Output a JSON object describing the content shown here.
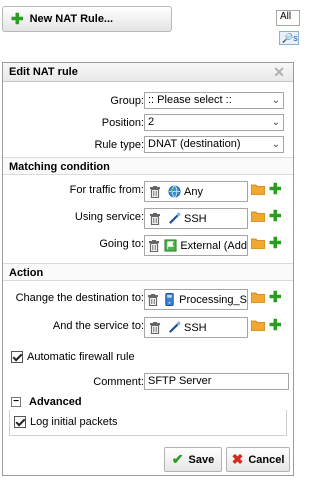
{
  "toolbar": {
    "new_rule_label": "New NAT Rule...",
    "filter_value": "All",
    "search_chip": "s"
  },
  "dialog": {
    "title": "Edit NAT rule",
    "group": {
      "label": "Group:",
      "value": ":: Please select ::"
    },
    "position": {
      "label": "Position:",
      "value": "2"
    },
    "rule_type": {
      "label": "Rule type:",
      "value": "DNAT (destination)"
    },
    "matching": {
      "heading": "Matching condition",
      "traffic_from": {
        "label": "For traffic from:",
        "value": "Any",
        "icon": "globe-icon"
      },
      "using_service": {
        "label": "Using service:",
        "value": "SSH",
        "icon": "service-icon"
      },
      "going_to": {
        "label": "Going to:",
        "value": "External (Add",
        "icon": "interface-icon"
      }
    },
    "action": {
      "heading": "Action",
      "change_destination": {
        "label": "Change the destination to:",
        "value": "Processing_S",
        "icon": "host-icon"
      },
      "service_to": {
        "label": "And the service to:",
        "value": "SSH",
        "icon": "service-icon"
      }
    },
    "auto_firewall": {
      "label": "Automatic firewall rule",
      "checked": true
    },
    "comment": {
      "label": "Comment:",
      "value": "SFTP Server"
    },
    "advanced": {
      "heading": "Advanced",
      "collapse_symbol": "−",
      "log_initial": {
        "label": "Log initial packets",
        "checked": true
      }
    },
    "buttons": {
      "save": "Save",
      "cancel": "Cancel"
    }
  },
  "colors": {
    "add_green": "#2d9c22",
    "cancel_red": "#d12a1f",
    "folder_orange": "#f0a830"
  }
}
